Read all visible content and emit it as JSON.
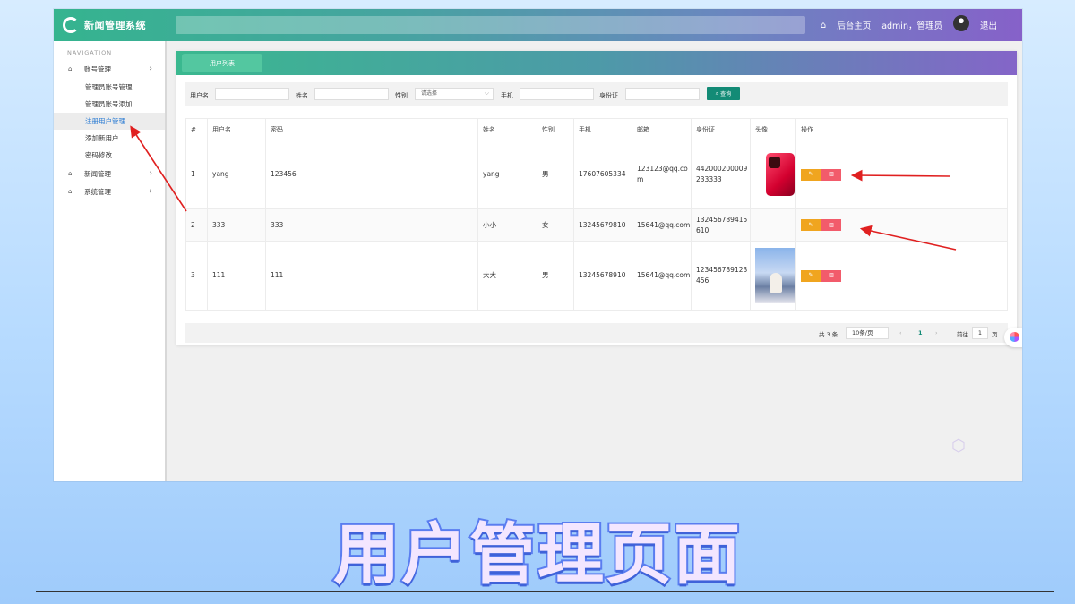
{
  "header": {
    "app_title": "新闻管理系统",
    "home_label": "后台主页",
    "user_label": "admin，管理员",
    "logout_label": "退出"
  },
  "sidebar": {
    "nav_title": "NAVIGATION",
    "groups": [
      {
        "label": "账号管理",
        "icon": "home-icon"
      },
      {
        "label": "新闻管理",
        "icon": "home-icon"
      },
      {
        "label": "系统管理",
        "icon": "home-icon"
      }
    ],
    "sub_items": [
      {
        "label": "管理员账号管理"
      },
      {
        "label": "管理员账号添加"
      },
      {
        "label": "注册用户管理",
        "active": true
      },
      {
        "label": "添加新用户"
      },
      {
        "label": "密码修改"
      }
    ]
  },
  "main": {
    "tab_label": "用户列表",
    "filters": {
      "username_label": "用户名",
      "name_label": "姓名",
      "gender_label": "性别",
      "gender_placeholder": "请选择",
      "phone_label": "手机",
      "idcard_label": "身份证",
      "search_button": "查询"
    },
    "table": {
      "headers": [
        "#",
        "用户名",
        "密码",
        "姓名",
        "性别",
        "手机",
        "邮箱",
        "身份证",
        "头像",
        "操作"
      ],
      "rows": [
        {
          "idx": "1",
          "username": "yang",
          "password": "123456",
          "name": "yang",
          "gender": "男",
          "phone": "17607605334",
          "email": "123123@qq.com",
          "idcard": "442000200009233333",
          "avatar": "phone-photo"
        },
        {
          "idx": "2",
          "username": "333",
          "password": "333",
          "name": "小小",
          "gender": "女",
          "phone": "13245679810",
          "email": "15641@qq.com",
          "idcard": "132456789415610",
          "avatar": ""
        },
        {
          "idx": "3",
          "username": "111",
          "password": "111",
          "name": "大大",
          "gender": "男",
          "phone": "13245678910",
          "email": "15641@qq.com",
          "idcard": "123456789123456",
          "avatar": "person-photo"
        }
      ],
      "edit_icon": "✎",
      "delete_icon": "▥"
    },
    "pager": {
      "total": "共 3 条",
      "page_size": "10条/页",
      "current_page": "1",
      "goto_label": "前往",
      "goto_value": "1",
      "page_unit": "页"
    }
  },
  "caption": "用户管理页面",
  "colors": {
    "header_start": "#35b48f",
    "header_end": "#8661c9",
    "primary": "#138b76",
    "edit": "#f0a51f",
    "delete": "#f25b6b",
    "arrow": "#e02020"
  }
}
